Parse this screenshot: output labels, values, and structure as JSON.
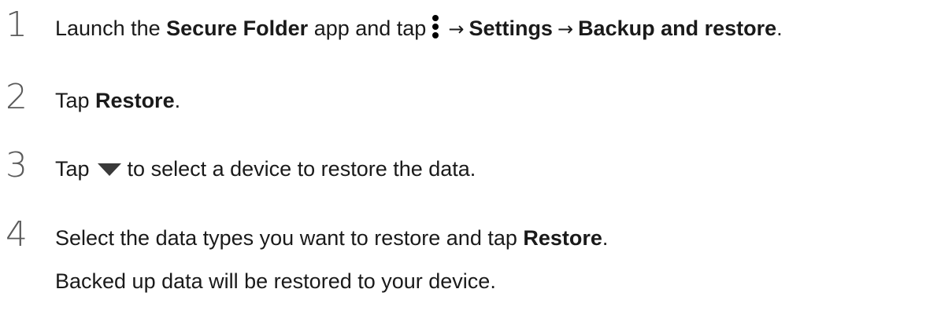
{
  "steps": [
    {
      "number": "1",
      "pre": "Launch the ",
      "app_name": "Secure Folder",
      "mid": " app and tap",
      "arrow_1": "→",
      "settings": "Settings",
      "arrow_2": "→",
      "backup_restore": "Backup and restore",
      "end": ".",
      "icon": "more-options-icon"
    },
    {
      "number": "2",
      "pre": "Tap ",
      "bold": "Restore",
      "end": "."
    },
    {
      "number": "3",
      "pre": "Tap",
      "post": "to select a device to restore the data.",
      "icon": "dropdown-triangle-icon"
    },
    {
      "number": "4",
      "pre": "Select the data types you want to restore and tap ",
      "bold": "Restore",
      "end": ".",
      "note": "Backed up data will be restored to your device."
    }
  ]
}
